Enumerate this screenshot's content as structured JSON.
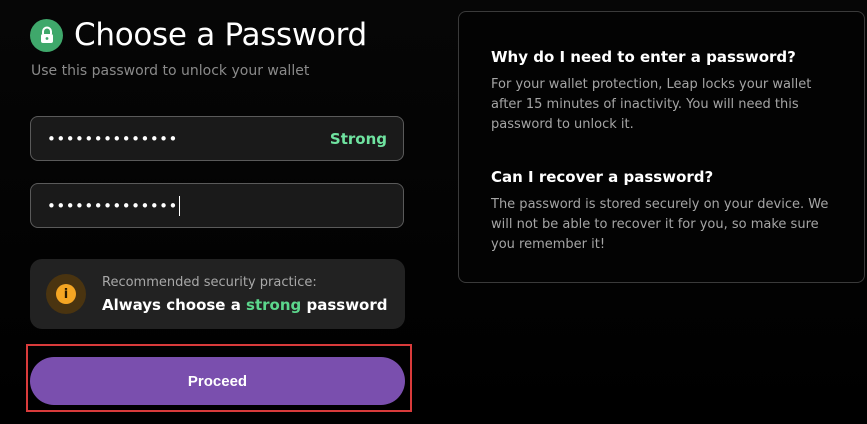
{
  "header": {
    "title": "Choose a Password",
    "subtitle": "Use this password to unlock your wallet"
  },
  "password_field": {
    "masked_value": "••••••••••••••",
    "strength_label": "Strong"
  },
  "confirm_field": {
    "masked_value": "••••••••••••••"
  },
  "tip": {
    "label": "Recommended security practice:",
    "main_prefix": "Always choose a ",
    "main_highlight": "strong",
    "main_suffix": " password",
    "icon": "info-icon"
  },
  "proceed_button": {
    "label": "Proceed"
  },
  "faq": {
    "items": [
      {
        "question": "Why do I need to enter a password?",
        "answer": "For your wallet protection, Leap locks your wallet after 15 minutes of inactivity. You will need this password to unlock it."
      },
      {
        "question": "Can I recover a password?",
        "answer": "The password is stored securely on your device. We will not be able to recover it for you, so make sure you remember it!"
      }
    ]
  },
  "colors": {
    "accent_green": "#3fa86b",
    "strength_green": "#6fe3a0",
    "primary_button": "#7a4fae",
    "highlight_outline": "#d93b3b",
    "warning_icon": "#f5a623"
  }
}
